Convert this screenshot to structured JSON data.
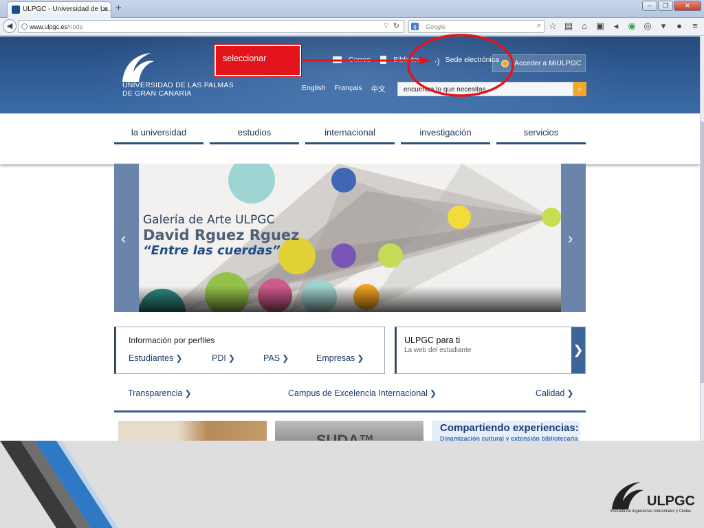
{
  "browser": {
    "tab_title": "ULPGC - Universidad de La...",
    "tab_close": "×",
    "new_tab": "+",
    "url_host": "www.ulpgc.es",
    "url_path": "/node",
    "search_placeholder": "Google",
    "window_controls": [
      "–",
      "❐",
      "✕"
    ]
  },
  "header": {
    "logo_line1": "UNIVERSIDAD DE LAS PALMAS",
    "logo_line2": "DE GRAN CANARIA",
    "top_links": [
      "Correo",
      "Biblioteca",
      "Sede electrónica"
    ],
    "login_button": "Acceder a MiULPGC",
    "languages": [
      "English",
      "Français",
      "中文"
    ],
    "search_value": "encuentra lo que necesitas"
  },
  "annotation": {
    "label": "seleccionar",
    "color": "#e3141b"
  },
  "nav": [
    "la universidad",
    "estudios",
    "internacional",
    "investigación",
    "servicios"
  ],
  "carousel": {
    "line1": "Galería de Arte ULPGC",
    "line2": "David Rguez Rguez",
    "line3": "“Entre las cuerdas”",
    "prev": "‹",
    "next": "›"
  },
  "profiles": {
    "title": "Información por perfiles",
    "links": [
      "Estudiantes",
      "PDI",
      "PAS",
      "Empresas"
    ]
  },
  "ulpgc_ti": {
    "title": "ULPGC para ti",
    "subtitle": "La web del estudiante"
  },
  "bottom_links": [
    "Transparencia",
    "Campus de Excelencia Internacional",
    "Calidad"
  ],
  "thumbs": {
    "second_text": "SUDA™",
    "third_title": "Compartiendo experiencias:",
    "third_sub": "Dinamización cultural y extensión bibliotecaria"
  },
  "footer": {
    "logo_text": "ULPGC",
    "school": "Escuela de Ingenierías Industriales y Civiles"
  },
  "colors": {
    "header_blue": "#315d96",
    "accent_orange": "#f5a623",
    "nav_underline": "#2a4f7f"
  }
}
